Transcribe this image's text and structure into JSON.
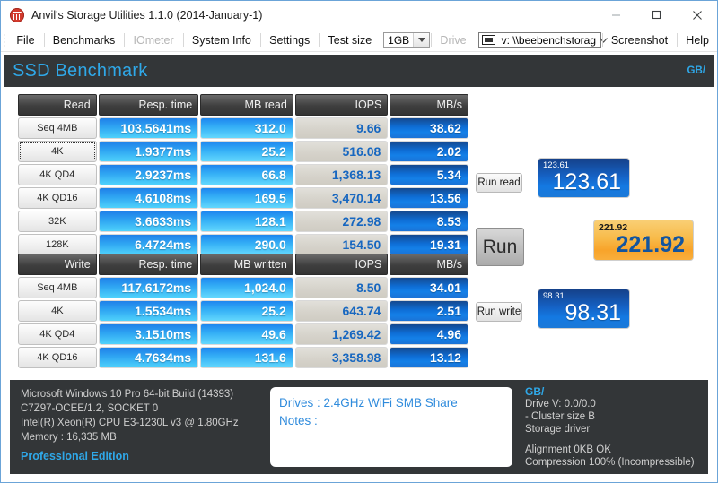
{
  "window": {
    "title": "Anvil's Storage Utilities 1.1.0 (2014-January-1)",
    "icon": "anvil-icon",
    "minimize": "minimize-icon",
    "maximize": "maximize-icon",
    "close": "close-icon"
  },
  "menu": {
    "items": [
      {
        "label": "File",
        "disabled": false
      },
      {
        "label": "Benchmarks",
        "disabled": false
      },
      {
        "label": "IOmeter",
        "disabled": true
      },
      {
        "label": "System Info",
        "disabled": false
      },
      {
        "label": "Settings",
        "disabled": false
      }
    ],
    "test_size_label": "Test size",
    "test_size_value": "1GB",
    "drive_label": "Drive",
    "drive_value": "v: \\\\beebenchstorag",
    "screenshot": "Screenshot",
    "help": "Help"
  },
  "banner": {
    "title": "SSD Benchmark",
    "unit": "GB/"
  },
  "read_table": {
    "headers": [
      "Read",
      "Resp. time",
      "MB read",
      "IOPS",
      "MB/s"
    ],
    "rows": [
      {
        "label": "Seq 4MB",
        "resp": "103.5641ms",
        "mb": "312.0",
        "iops": "9.66",
        "mbs": "38.62",
        "focus": false
      },
      {
        "label": "4K",
        "resp": "1.9377ms",
        "mb": "25.2",
        "iops": "516.08",
        "mbs": "2.02",
        "focus": true
      },
      {
        "label": "4K QD4",
        "resp": "2.9237ms",
        "mb": "66.8",
        "iops": "1,368.13",
        "mbs": "5.34",
        "focus": false
      },
      {
        "label": "4K QD16",
        "resp": "4.6108ms",
        "mb": "169.5",
        "iops": "3,470.14",
        "mbs": "13.56",
        "focus": false
      },
      {
        "label": "32K",
        "resp": "3.6633ms",
        "mb": "128.1",
        "iops": "272.98",
        "mbs": "8.53",
        "focus": false
      },
      {
        "label": "128K",
        "resp": "6.4724ms",
        "mb": "290.0",
        "iops": "154.50",
        "mbs": "19.31",
        "focus": false
      }
    ]
  },
  "write_table": {
    "headers": [
      "Write",
      "Resp. time",
      "MB written",
      "IOPS",
      "MB/s"
    ],
    "rows": [
      {
        "label": "Seq 4MB",
        "resp": "117.6172ms",
        "mb": "1,024.0",
        "iops": "8.50",
        "mbs": "34.01",
        "focus": false
      },
      {
        "label": "4K",
        "resp": "1.5534ms",
        "mb": "25.2",
        "iops": "643.74",
        "mbs": "2.51",
        "focus": false
      },
      {
        "label": "4K QD4",
        "resp": "3.1510ms",
        "mb": "49.6",
        "iops": "1,269.42",
        "mbs": "4.96",
        "focus": false
      },
      {
        "label": "4K QD16",
        "resp": "4.7634ms",
        "mb": "131.6",
        "iops": "3,358.98",
        "mbs": "13.12",
        "focus": false
      }
    ]
  },
  "controls": {
    "run_read": "Run read",
    "run": "Run",
    "run_write": "Run write",
    "read_score_small": "123.61",
    "read_score": "123.61",
    "total_score_small": "221.92",
    "total_score": "221.92",
    "write_score_small": "98.31",
    "write_score": "98.31"
  },
  "system_info": {
    "os": "Microsoft Windows 10 Pro 64-bit Build (14393)",
    "board": "C7Z97-OCEE/1.2, SOCKET 0",
    "cpu": "Intel(R) Xeon(R) CPU E3-1230L v3 @ 1.80GHz",
    "memory": "Memory : 16,335 MB",
    "edition": "Professional Edition"
  },
  "notes": {
    "drives": "Drives : 2.4GHz WiFi SMB Share",
    "notes": "Notes :"
  },
  "drive_info": {
    "unit": "GB/",
    "drive": "Drive V: 0.0/0.0",
    "cluster": "- Cluster size B",
    "driver": "Storage driver",
    "alignment": "Alignment 0KB OK",
    "compression": "Compression 100% (Incompressible)"
  }
}
